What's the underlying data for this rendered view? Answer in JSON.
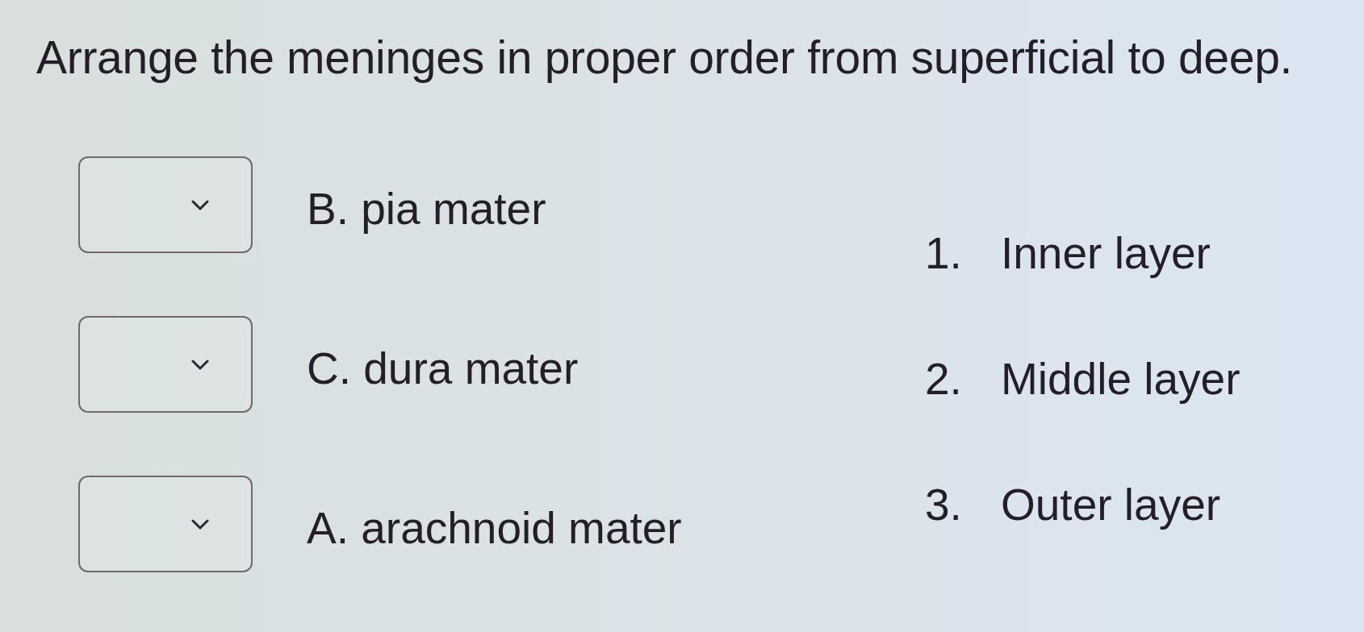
{
  "question": "Arrange the meninges in proper order from superficial to deep.",
  "items": [
    {
      "label": "B. pia mater"
    },
    {
      "label": "C. dura mater"
    },
    {
      "label": "A. arachnoid mater"
    }
  ],
  "options": [
    {
      "number": "1.",
      "text": "Inner layer"
    },
    {
      "number": "2.",
      "text": "Middle layer"
    },
    {
      "number": "3.",
      "text": "Outer layer"
    }
  ]
}
